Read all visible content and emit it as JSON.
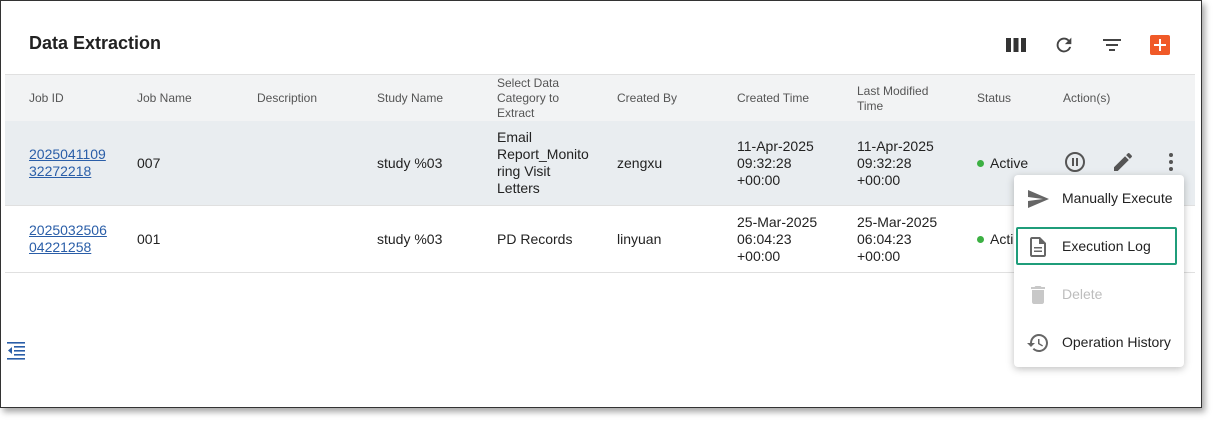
{
  "page": {
    "title": "Data Extraction"
  },
  "toolbar": {
    "columns_icon": "view-column-icon",
    "refresh_icon": "refresh-icon",
    "filter_icon": "filter-icon",
    "add_icon": "add-box-icon",
    "accent": "#f05a28"
  },
  "table": {
    "headers": [
      "Job ID",
      "Job Name",
      "Description",
      "Study Name",
      "Select Data Category to Extract",
      "Created By",
      "Created Time",
      "Last Modified Time",
      "Status",
      "Action(s)"
    ],
    "header_lines": {
      "category": [
        "Select Data",
        "Category to",
        "Extract"
      ],
      "modified": [
        "Last Modified",
        "Time"
      ]
    },
    "rows": [
      {
        "job_id_lines": [
          "2025041109",
          "32272218"
        ],
        "job_name": "007",
        "description": "",
        "study_name": "study %03",
        "category_lines": [
          "Email",
          "Report_Monito",
          "ring Visit",
          "Letters"
        ],
        "created_by": "zengxu",
        "created_lines": [
          "11-Apr-2025",
          "09:32:28",
          "+00:00"
        ],
        "modified_lines": [
          "11-Apr-2025",
          "09:32:28",
          "+00:00"
        ],
        "status": "Active"
      },
      {
        "job_id_lines": [
          "2025032506",
          "04221258"
        ],
        "job_name": "001",
        "description": "",
        "study_name": "study %03",
        "category_lines": [
          "PD Records"
        ],
        "created_by": "linyuan",
        "created_lines": [
          "25-Mar-2025",
          "06:04:23",
          "+00:00"
        ],
        "modified_lines": [
          "25-Mar-2025",
          "06:04:23",
          "+00:00"
        ],
        "status": "Acti"
      }
    ],
    "status_color": "#3cb043"
  },
  "menu": {
    "items": [
      {
        "label": "Manually Execute",
        "icon": "send-icon"
      },
      {
        "label": "Execution Log",
        "icon": "document-icon"
      },
      {
        "label": "Delete",
        "icon": "delete-icon",
        "disabled": true
      },
      {
        "label": "Operation History",
        "icon": "history-icon"
      }
    ]
  }
}
